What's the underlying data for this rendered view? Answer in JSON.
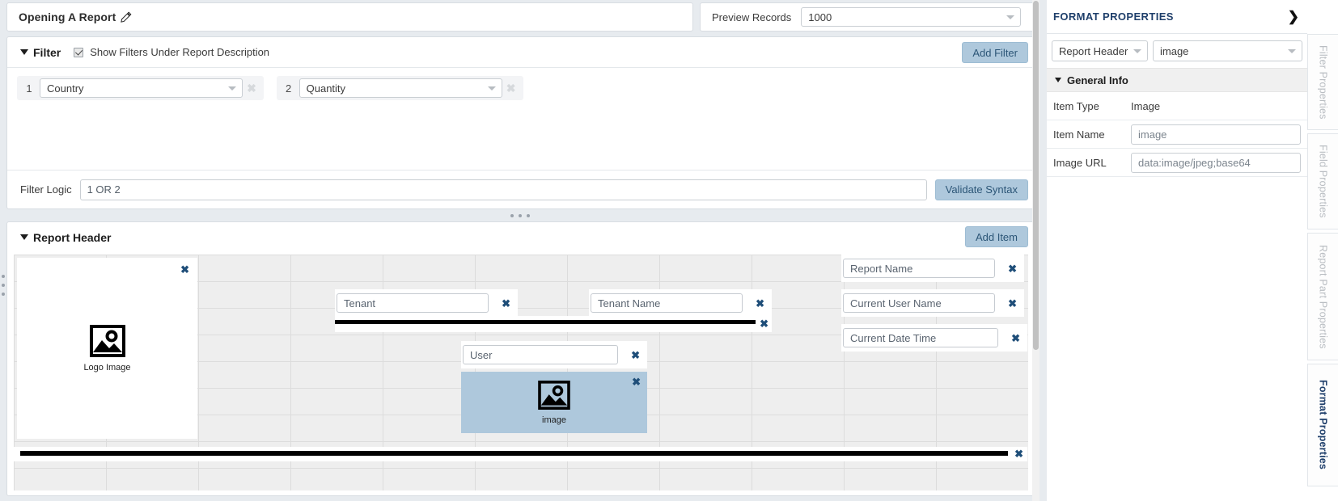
{
  "topbar": {
    "report_title": "Opening A Report",
    "edit_icon": "pencil-icon",
    "preview_label": "Preview Records",
    "preview_value": "1000"
  },
  "filter": {
    "section_title": "Filter",
    "show_filters_label": "Show Filters Under Report Description",
    "show_filters_checked": true,
    "add_filter_label": "Add Filter",
    "rows": [
      {
        "num": "1",
        "field": "Country"
      },
      {
        "num": "2",
        "field": "Quantity"
      }
    ],
    "remove_icon": "✖",
    "logic_label": "Filter Logic",
    "logic_value": "1 OR 2",
    "validate_label": "Validate Syntax"
  },
  "report_header": {
    "section_title": "Report Header",
    "add_item_label": "Add Item",
    "remove_icon": "✖",
    "items": [
      {
        "name": "logo-image",
        "caption": "Logo Image",
        "type": "image"
      },
      {
        "name": "tenant-field",
        "value": "Tenant",
        "type": "field"
      },
      {
        "name": "tenant-name-field",
        "value": "Tenant Name",
        "type": "field"
      },
      {
        "name": "report-name-field",
        "value": "Report Name",
        "type": "field"
      },
      {
        "name": "current-user-name-field",
        "value": "Current User Name",
        "type": "field"
      },
      {
        "name": "current-date-time-field",
        "value": "Current Date Time",
        "type": "field"
      },
      {
        "name": "horizontal-line-top",
        "value": "",
        "type": "line"
      },
      {
        "name": "user-field",
        "value": "User",
        "type": "field"
      },
      {
        "name": "selected-image",
        "caption": "image",
        "type": "image",
        "selected": true
      },
      {
        "name": "horizontal-line-bottom",
        "value": "",
        "type": "line"
      }
    ]
  },
  "properties": {
    "panel_title": "FORMAT PROPERTIES",
    "collapse_icon": "❯",
    "part_select": "Report Header",
    "item_select": "image",
    "general_info_label": "General Info",
    "rows": [
      {
        "key": "Item Type",
        "value": "Image",
        "editable": false
      },
      {
        "key": "Item Name",
        "value": "image",
        "editable": true
      },
      {
        "key": "Image URL",
        "value": "data:image/jpeg;base64",
        "editable": true
      }
    ],
    "tabs": [
      {
        "label": "Filter Properties",
        "active": false
      },
      {
        "label": "Field Properties",
        "active": false
      },
      {
        "label": "Report Part Properties",
        "active": false
      },
      {
        "label": "Format Properties",
        "active": true
      }
    ]
  },
  "colors": {
    "accent_button": "#aec8dc",
    "accent_text": "#2c5677",
    "panel_title": "#1f3f6b",
    "selection": "#aec8dc"
  }
}
